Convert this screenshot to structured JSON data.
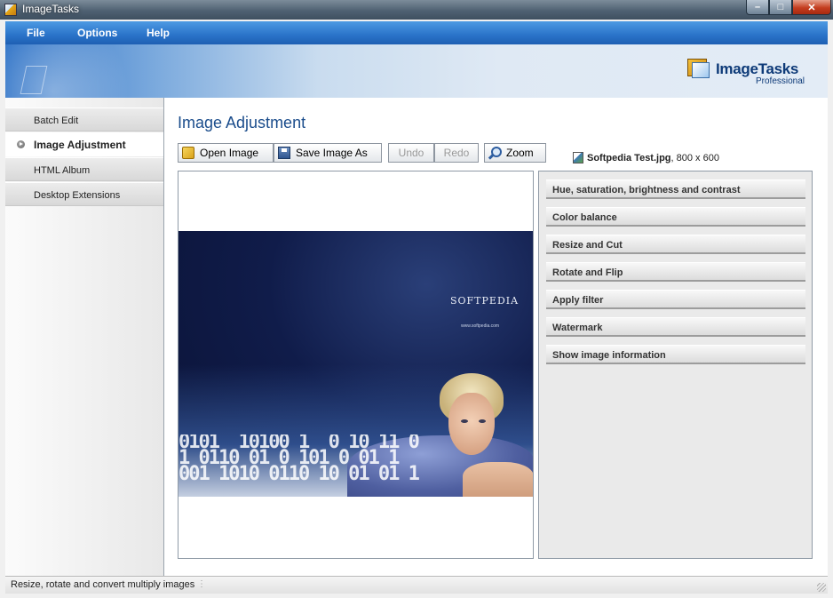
{
  "window": {
    "title": "ImageTasks"
  },
  "menu": {
    "file": "File",
    "options": "Options",
    "help": "Help"
  },
  "brand": {
    "name": "ImageTasks",
    "edition": "Professional",
    "icon": "imagetasks-logo-icon"
  },
  "sidebar": {
    "items": [
      {
        "label": "Batch Edit",
        "active": false
      },
      {
        "label": "Image Adjustment",
        "active": true
      },
      {
        "label": "HTML Album",
        "active": false
      },
      {
        "label": "Desktop Extensions",
        "active": false
      }
    ]
  },
  "main": {
    "title": "Image Adjustment",
    "toolbar": {
      "open": "Open Image",
      "save": "Save Image As",
      "undo": "Undo",
      "redo": "Redo",
      "zoom": "Zoom"
    },
    "file": {
      "name": "Softpedia Test.jpg",
      "dims": ", 800 x 600"
    },
    "preview": {
      "logo": "SOFTPEDIA",
      "url": "www.softpedia.com",
      "digits": "0101  10100 1  0 10 11 0\n1 0110 01 0 101 0 01 1\n001 1010 0110 10 01 01 1"
    },
    "options": [
      "Hue, saturation, brightness and contrast",
      "Color balance",
      "Resize and Cut",
      "Rotate and Flip",
      "Apply filter",
      "Watermark",
      "Show image information"
    ]
  },
  "status": {
    "text": "Resize, rotate and convert multiply images"
  },
  "colors": {
    "menubar": "#2a73c9",
    "title_text": "#1b4d8c",
    "brand_text": "#0d3a78"
  }
}
